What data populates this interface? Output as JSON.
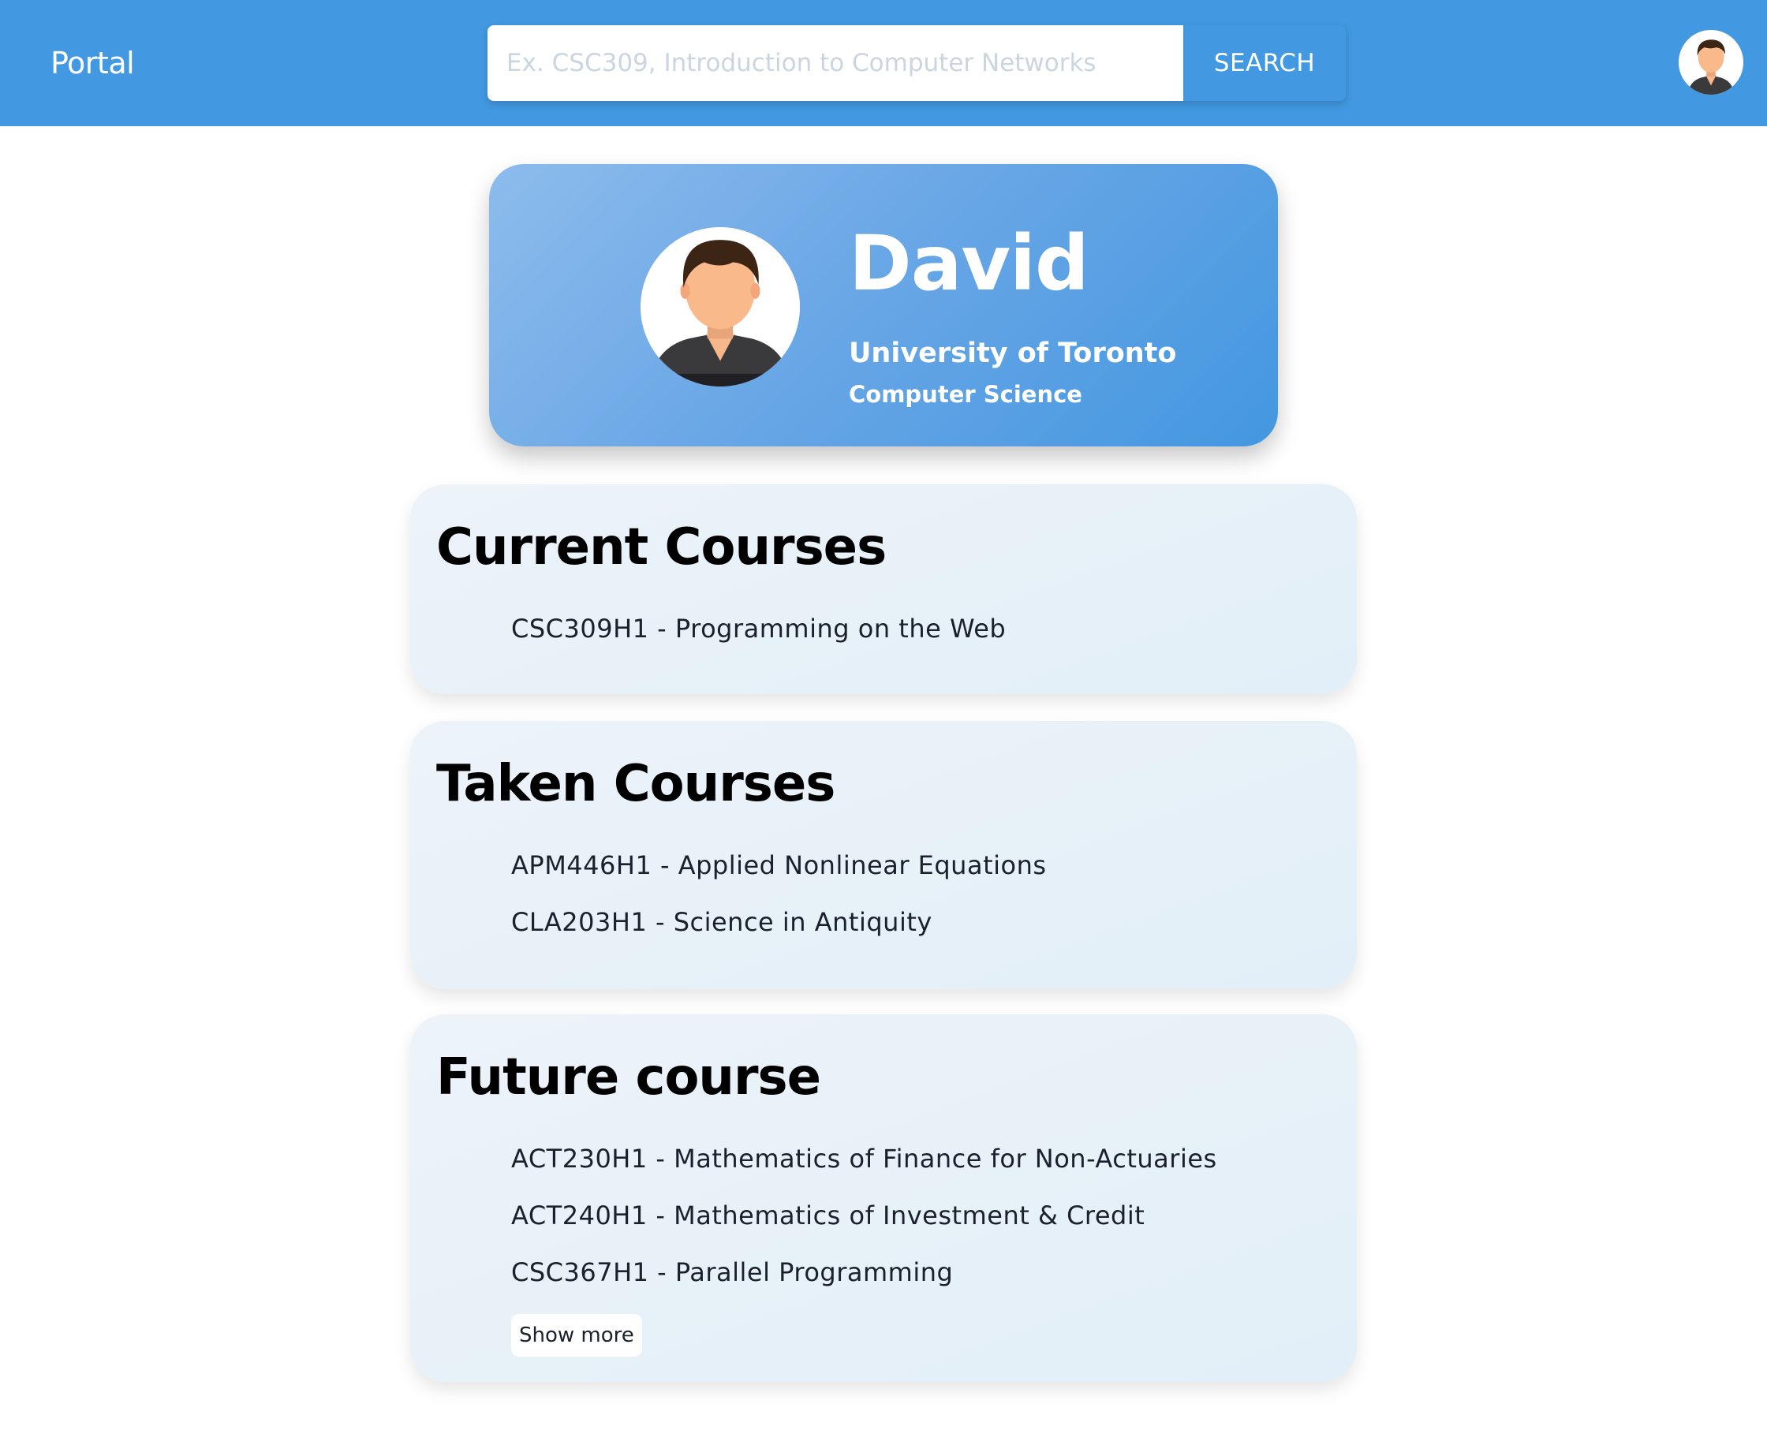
{
  "header": {
    "brand": "Portal",
    "search": {
      "placeholder": "Ex. CSC309, Introduction to Computer Networks",
      "value": "",
      "button_label": "SEARCH"
    },
    "avatar_icon": "user-avatar-icon"
  },
  "profile": {
    "name": "David",
    "university": "University of Toronto",
    "program": "Computer Science",
    "avatar_icon": "user-avatar-icon"
  },
  "sections": {
    "current": {
      "title": "Current Courses",
      "courses": [
        "CSC309H1 - Programming on the Web"
      ]
    },
    "taken": {
      "title": "Taken Courses",
      "courses": [
        "APM446H1 - Applied Nonlinear Equations",
        "CLA203H1 - Science in Antiquity"
      ]
    },
    "future": {
      "title": "Future course",
      "courses": [
        "ACT230H1 - Mathematics of Finance for Non-Actuaries",
        "ACT240H1 - Mathematics of Investment & Credit",
        "CSC367H1 - Parallel Programming"
      ],
      "show_more_label": "Show more"
    }
  },
  "colors": {
    "header_bg": "#4299e1",
    "profile_gradient_start": "#8dbcec",
    "profile_gradient_end": "#4397e0",
    "card_bg": "#e8f1f8"
  }
}
